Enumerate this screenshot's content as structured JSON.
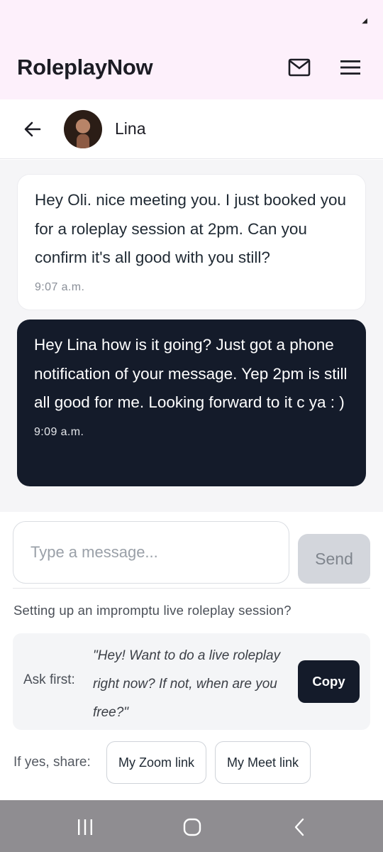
{
  "app": {
    "title": "RoleplayNow"
  },
  "icons": {
    "mail": "mail-icon",
    "menu": "hamburger-menu-icon",
    "back": "arrow-left-icon"
  },
  "contact": {
    "name": "Lina"
  },
  "messages": [
    {
      "direction": "incoming",
      "text": "Hey Oli. nice meeting you.  I just booked you for a roleplay session at 2pm. Can you confirm it's all good with you still?",
      "time": "9:07 a.m."
    },
    {
      "direction": "outgoing",
      "text": "Hey Lina how is it going? Just got a phone notification of your message. Yep 2pm is still all good for me. Looking forward to it c ya : )",
      "time": "9:09 a.m."
    }
  ],
  "compose": {
    "placeholder": "Type a message...",
    "send_label": "Send"
  },
  "tip": {
    "heading": "Setting up an impromptu live roleplay session?",
    "ask_label": "Ask first:",
    "quote": "\"Hey! Want to do a live roleplay right now? If not, when are you free?\"",
    "copy_label": "Copy"
  },
  "share": {
    "label": "If yes, share:",
    "zoom_label": "My Zoom link",
    "meet_label": "My Meet link"
  },
  "colors": {
    "header_bg": "#fdf0fb",
    "outgoing_bubble": "#141b2a",
    "nav_bar": "#8f8d91"
  }
}
